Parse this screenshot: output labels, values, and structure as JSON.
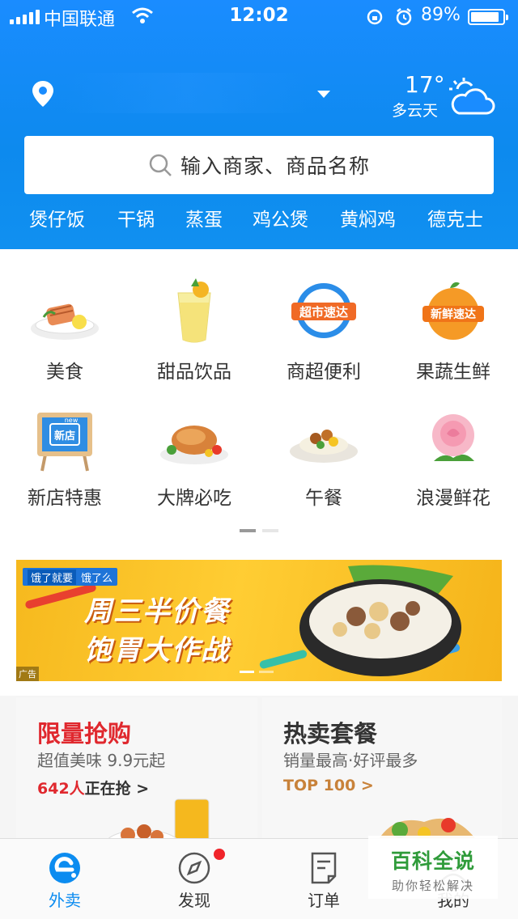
{
  "status_bar": {
    "carrier": "中国联通",
    "time": "12:02",
    "battery": "89%",
    "battery_level": 0.89
  },
  "location": {
    "temperature": "17°",
    "weather": "多云天"
  },
  "search": {
    "placeholder": "输入商家、商品名称"
  },
  "hot_words": [
    "煲仔饭",
    "干锅",
    "蒸蛋",
    "鸡公煲",
    "黄焖鸡",
    "德克士"
  ],
  "categories": [
    {
      "label": "美食",
      "icon": "food-icon"
    },
    {
      "label": "甜品饮品",
      "icon": "drink-icon"
    },
    {
      "label": "商超便利",
      "icon": "supermarket-icon",
      "badge": "超市速达"
    },
    {
      "label": "果蔬生鲜",
      "icon": "fresh-icon",
      "badge": "新鲜速达"
    },
    {
      "label": "新店特惠",
      "icon": "new-store-icon",
      "badge": "新店",
      "badge_top": "new"
    },
    {
      "label": "大牌必吃",
      "icon": "roast-chicken-icon"
    },
    {
      "label": "午餐",
      "icon": "lunch-icon"
    },
    {
      "label": "浪漫鲜花",
      "icon": "flower-icon"
    }
  ],
  "banner": {
    "tag_a": "饿了就要",
    "tag_b": "饿了么",
    "line1": "周三半价餐",
    "line2": "饱胃大作战",
    "ad_label": "广告"
  },
  "promos": [
    {
      "title": "限量抢购",
      "subtitle": "超值美味 9.9元起",
      "meta_strong": "642人",
      "meta_rest": "正在抢 >",
      "title_color": "#e0282e"
    },
    {
      "title": "热卖套餐",
      "subtitle": "销量最高·好评最多",
      "meta_strong": "TOP 100 >",
      "meta_rest": "",
      "title_color": "#333333"
    }
  ],
  "tabs": [
    {
      "label": "外卖",
      "icon": "eleme-icon",
      "active": true
    },
    {
      "label": "发现",
      "icon": "compass-icon"
    },
    {
      "label": "订单",
      "icon": "order-icon"
    },
    {
      "label": "我的",
      "icon": "profile-icon"
    }
  ],
  "watermark": {
    "title": "百科全说",
    "subtitle": "助你轻松解决"
  },
  "colors": {
    "brand_blue": "#0c8cf0",
    "promo_red": "#e0282e",
    "gold": "#c8823a"
  }
}
